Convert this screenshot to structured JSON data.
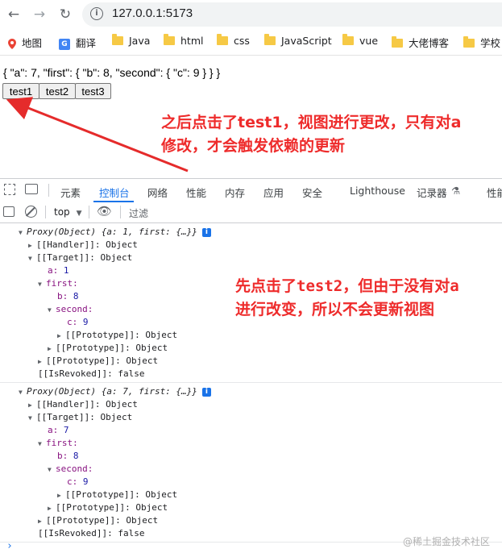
{
  "browser": {
    "url": "127.0.0.1:5173",
    "bookmarks": [
      "地图",
      "翻译",
      "Java",
      "html",
      "css",
      "JavaScript",
      "vue",
      "大佬博客",
      "学校"
    ]
  },
  "page": {
    "json_text": "{ \"a\": 7, \"first\": { \"b\": 8, \"second\": { \"c\": 9 } } }",
    "buttons": [
      "test1",
      "test2",
      "test3"
    ]
  },
  "annotations": {
    "top_line1": "之后点击了test1，视图进行更改，只有对a",
    "top_line2": "修改，才会触发依赖的更新",
    "mid_line1": "先点击了test2，但由于没有对a",
    "mid_line2": "进行改变，所以不会更新视图",
    "color": "#ee2b2b"
  },
  "devtools": {
    "tabs": [
      "元素",
      "控制台",
      "网络",
      "性能",
      "内存",
      "应用",
      "安全",
      "Lighthouse",
      "记录器",
      "性能"
    ],
    "active_tab": "控制台",
    "context": "top",
    "filter_placeholder": "过滤"
  },
  "console": {
    "log1": {
      "header": "Proxy(Object) {a: 1, first: {…}}",
      "handler": "[[Handler]]: Object",
      "target": "[[Target]]: Object",
      "a_key": "a:",
      "a_val": "1",
      "first_key": "first:",
      "b_key": "b:",
      "b_val": "8",
      "second_key": "second:",
      "c_key": "c:",
      "c_val": "9",
      "proto1": "[[Prototype]]: Object",
      "proto2": "[[Prototype]]: Object",
      "proto3": "[[Prototype]]: Object",
      "revoked": "[[IsRevoked]]: false"
    },
    "log2": {
      "header": "Proxy(Object) {a: 7, first: {…}}",
      "handler": "[[Handler]]: Object",
      "target": "[[Target]]: Object",
      "a_key": "a:",
      "a_val": "7",
      "first_key": "first:",
      "b_key": "b:",
      "b_val": "8",
      "second_key": "second:",
      "c_key": "c:",
      "c_val": "9",
      "proto1": "[[Prototype]]: Object",
      "proto2": "[[Prototype]]: Object",
      "proto3": "[[Prototype]]: Object",
      "revoked": "[[IsRevoked]]: false"
    },
    "prompt": "›",
    "watermark": "@稀土掘金技术社区"
  }
}
